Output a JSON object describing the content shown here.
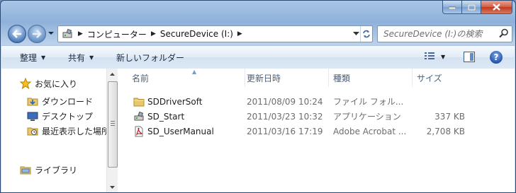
{
  "window": {
    "caption_buttons": [
      "minimize-icon",
      "maximize-icon",
      "close-icon"
    ]
  },
  "address": {
    "breadcrumbs": [
      "コンピューター",
      "SecureDevice (I:)"
    ],
    "search_placeholder": "SecureDevice (I:)の検索"
  },
  "toolbar": {
    "organize_label": "整理",
    "share_label": "共有",
    "new_folder_label": "新しいフォルダー"
  },
  "nav": {
    "favorites_label": "お気に入り",
    "favorites_items": [
      "ダウンロード",
      "デスクトップ",
      "最近表示した場所"
    ],
    "libraries_label": "ライブラリ"
  },
  "columns": [
    "名前",
    "更新日時",
    "種類",
    "サイズ"
  ],
  "files": [
    {
      "name": "SDDriverSoft",
      "date": "2011/08/09 10:24",
      "type": "ファイル フォル...",
      "size": "",
      "icon": "folder-icon"
    },
    {
      "name": "SD_Start",
      "date": "2011/03/23 10:32",
      "type": "アプリケーション",
      "size": "337 KB",
      "icon": "application-icon"
    },
    {
      "name": "SD_UserManual",
      "date": "2011/03/16 17:19",
      "type": "Adobe Acrobat ...",
      "size": "2,708 KB",
      "icon": "pdf-icon"
    }
  ],
  "colors": {
    "chrome": "#a9c6e6",
    "close_red": "#c03a1f",
    "secondary_text": "#6d6d6d",
    "header_text": "#4c607a"
  }
}
